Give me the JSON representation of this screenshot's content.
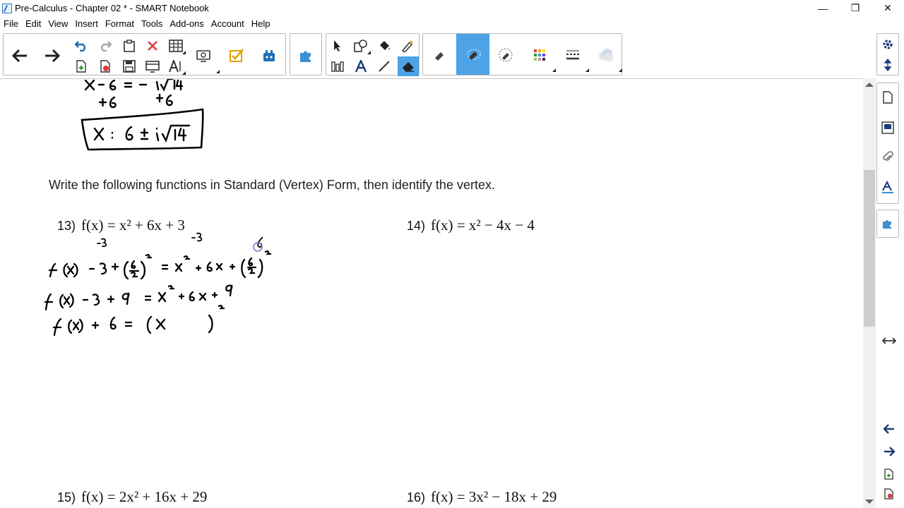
{
  "window": {
    "title": "Pre-Calculus - Chapter 02 * - SMART Notebook",
    "minimize_glyph": "—",
    "restore_glyph": "❐",
    "close_glyph": "✕"
  },
  "menu": [
    "File",
    "Edit",
    "View",
    "Insert",
    "Format",
    "Tools",
    "Add-ons",
    "Account",
    "Help"
  ],
  "toolbar": {
    "icons": [
      "back-arrow-icon",
      "forward-arrow-icon",
      "undo-icon",
      "redo-icon",
      "paste-icon",
      "delete-icon",
      "table-icon",
      "add-page-icon",
      "delete-page-icon",
      "save-icon",
      "screen-shade-icon",
      "text-font-icon",
      "document-camera-icon",
      "response-icon",
      "add-ons-icon",
      "puzzle-icon",
      "select-icon",
      "shapes-icon",
      "fill-icon",
      "magic-pen-icon",
      "measurement-tools-icon",
      "text-icon",
      "line-icon",
      "eraser-icon",
      "pen-small-icon",
      "pen-medium-icon",
      "pen-large-icon",
      "color-palette-icon",
      "line-style-icon",
      "fill-effects-icon"
    ],
    "accent": "#4da3e6"
  },
  "rightbar": {
    "icons": [
      "settings-icon",
      "collapse-toolbar-icon",
      "page-sorter-icon",
      "gallery-icon",
      "attachments-icon",
      "properties-icon",
      "add-ons-tab-icon",
      "swap-sides-icon",
      "previous-page-icon",
      "next-page-icon",
      "add-page-icon",
      "delete-page-icon"
    ]
  },
  "page": {
    "instruction": "Write the following functions in Standard (Vertex) Form, then identify the vertex.",
    "problems": [
      {
        "num": "13)",
        "fn": "f(x) = x² + 6x + 3"
      },
      {
        "num": "14)",
        "fn": "f(x) = x² − 4x − 4"
      },
      {
        "num": "15)",
        "fn": "f(x) = 2x² + 16x + 29"
      },
      {
        "num": "16)",
        "fn": "f(x) = 3x² − 18x + 29"
      }
    ],
    "handwriting": {
      "prev_line1": "x - 6 = ± i√14",
      "prev_line2": "+6        +6",
      "boxed_answer": "x = 6 ± i√14",
      "note_minus3_a": "-3",
      "note_minus3_b": "-3",
      "step1": "f(x) - 3 + (6/2)² = x² + 6x + (6/2)²",
      "step2": "f(x) - 3 + 9 = x² + 6x + 9",
      "step3": "f(x) + 6 = (x     )²"
    }
  }
}
